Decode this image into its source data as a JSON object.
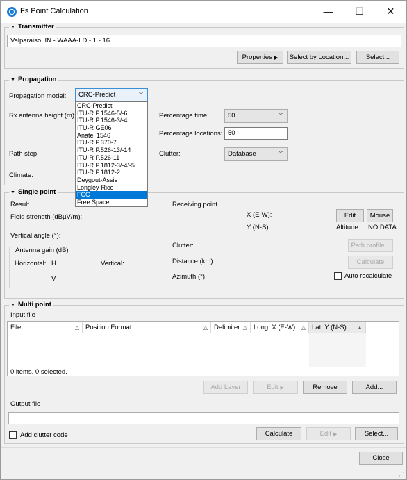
{
  "window": {
    "title": "Fs Point Calculation",
    "minimize": "—",
    "maximize": "☐",
    "close": "✕"
  },
  "transmitter": {
    "header": "Transmitter",
    "value": "Valparaiso, IN - WAAA-LD - 1 - 16",
    "properties_label": "Properties",
    "select_by_location_label": "Select by Location...",
    "select_label": "Select..."
  },
  "propagation": {
    "header": "Propagation",
    "model_label": "Propagation model:",
    "model_value": "CRC-Predict",
    "rx_height_label": "Rx antenna height (m):",
    "path_step_label": "Path step:",
    "climate_label": "Climate:",
    "percentage_time_label": "Percentage time:",
    "percentage_time_value": "50",
    "percentage_locations_label": "Percentage locations:",
    "percentage_locations_value": "50",
    "clutter_label": "Clutter:",
    "clutter_value": "Database",
    "options": [
      "CRC-Predict",
      "ITU-R P.1546-5/-6",
      "ITU-R P.1546-3/-4",
      "ITU-R GE06",
      "Anatel 1546",
      "ITU-R P.370-7",
      "ITU-R P.526-13/-14",
      "ITU-R P.526-11",
      "ITU-R P.1812-3/-4/-5",
      "ITU-R P.1812-2",
      "Deygout-Assis",
      "Longley-Rice",
      "FCC",
      "Free Space"
    ],
    "highlighted_option": "FCC"
  },
  "single_point": {
    "header": "Single point",
    "result_label": "Result",
    "field_strength_label": "Field strength (dBµV/m):",
    "vertical_angle_label": "Vertical angle (°):",
    "antenna_gain_label": "Antenna gain (dB)",
    "horizontal_label": "Horizontal:",
    "horizontal_h": "H",
    "horizontal_v": "V",
    "vertical_label": "Vertical:",
    "receiving_point_label": "Receiving point",
    "x_label": "X (E-W):",
    "y_label": "Y (N-S):",
    "edit_label": "Edit",
    "mouse_label": "Mouse",
    "altitude_label": "Altitude:",
    "altitude_value": "NO DATA",
    "clutter_label": "Clutter:",
    "distance_label": "Distance (km):",
    "azimuth_label": "Azimuth (°):",
    "path_profile_label": "Path profile...",
    "calculate_label": "Calculate",
    "auto_recalculate_label": "Auto recalculate"
  },
  "multi_point": {
    "header": "Multi point",
    "input_file_label": "Input file",
    "columns": [
      "File",
      "Position Format",
      "Delimiter",
      "Long, X (E-W)",
      "Lat, Y (N-S)"
    ],
    "status": "0 items. 0 selected.",
    "add_layer_label": "Add Layer",
    "edit_label": "Edit",
    "remove_label": "Remove",
    "add_label": "Add...",
    "output_file_label": "Output file",
    "output_file_value": "",
    "add_clutter_code_label": "Add clutter code",
    "calculate_label": "Calculate",
    "edit2_label": "Edit",
    "select_label": "Select..."
  },
  "close_label": "Close",
  "colors": {
    "accent": "#0078d7",
    "window_bg": "#f0f0f0",
    "button_bg": "#e1e1e1"
  }
}
